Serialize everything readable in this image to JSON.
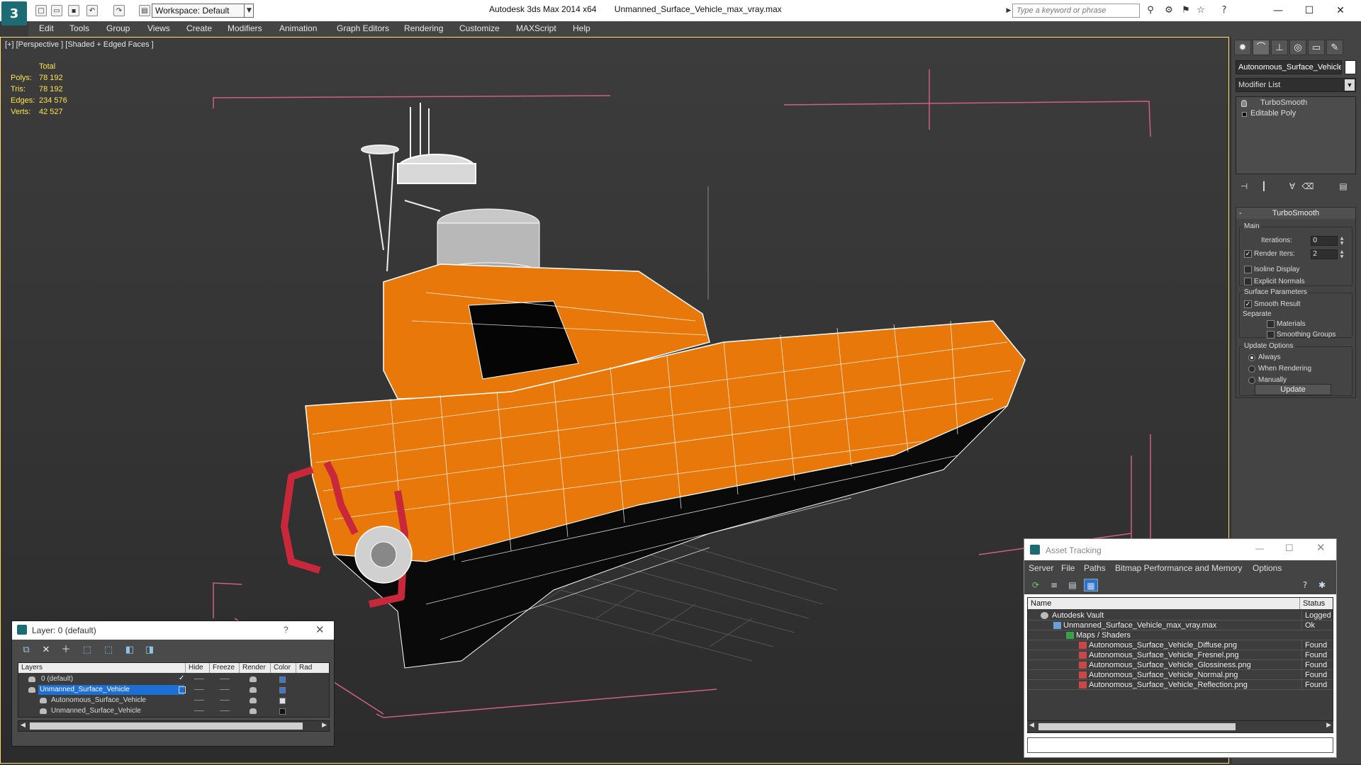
{
  "titlebar": {
    "app_name": "Autodesk 3ds Max  2014 x64",
    "file_name": "Unmanned_Surface_Vehicle_max_vray.max",
    "workspace": "Workspace: Default",
    "search_placeholder": "Type a keyword or phrase"
  },
  "menu": [
    "Edit",
    "Tools",
    "Group",
    "Views",
    "Create",
    "Modifiers",
    "Animation",
    "Graph Editors",
    "Rendering",
    "Customize",
    "MAXScript",
    "Help"
  ],
  "viewport": {
    "label": "[+] [Perspective ] [Shaded + Edged Faces ]",
    "stats": {
      "header": "Total",
      "rows": [
        {
          "label": "Polys:",
          "value": "78 192"
        },
        {
          "label": "Tris:",
          "value": "78 192"
        },
        {
          "label": "Edges:",
          "value": "234 576"
        },
        {
          "label": "Verts:",
          "value": "42 527"
        }
      ]
    },
    "colors": {
      "hull": "#e8780a",
      "wire": "#ffffff",
      "bbox": "#d06080",
      "grid": "#5a5a5a",
      "rail": "#c8283a"
    }
  },
  "command_panel": {
    "object_name": "Autonomous_Surface_Vehicle",
    "modifier_list": "Modifier List",
    "stack": [
      "TurboSmooth",
      "Editable Poly"
    ],
    "rollout": {
      "title": "TurboSmooth",
      "main_label": "Main",
      "iterations_label": "Iterations:",
      "iterations_value": "0",
      "render_iters_label": "Render Iters:",
      "render_iters_value": "2",
      "isoline_label": "Isoline Display",
      "explicit_normals_label": "Explicit Normals",
      "surface_label": "Surface Parameters",
      "smooth_result_label": "Smooth Result",
      "separate_label": "Separate",
      "materials_label": "Materials",
      "smoothing_groups_label": "Smoothing Groups",
      "update_options_label": "Update Options",
      "always_label": "Always",
      "when_rendering_label": "When Rendering",
      "manually_label": "Manually",
      "update_button": "Update"
    }
  },
  "layer_dialog": {
    "title": "Layer: 0 (default)",
    "help": "?",
    "columns": [
      "Layers",
      "Hide",
      "Freeze",
      "Render",
      "Color",
      "Rad"
    ],
    "rows": [
      {
        "name": "0 (default)",
        "color": "#3a78d8"
      },
      {
        "name": "Unmanned_Surface_Vehicle",
        "color": "#3a78d8"
      },
      {
        "name": "Autonomous_Surface_Vehicle",
        "color": "#e0e0e0"
      },
      {
        "name": "Unmanned_Surface_Vehicle",
        "color": "#111111"
      }
    ]
  },
  "asset_tracking": {
    "title": "Asset Tracking",
    "menu": [
      "Server",
      "File",
      "Paths",
      "Bitmap Performance and Memory",
      "Options"
    ],
    "columns": [
      "Name",
      "Status"
    ],
    "rows": [
      {
        "name": "Autodesk Vault",
        "status": "Logged O"
      },
      {
        "name": "Unmanned_Surface_Vehicle_max_vray.max",
        "status": "Ok"
      },
      {
        "name": "Maps / Shaders",
        "status": ""
      },
      {
        "name": "Autonomous_Surface_Vehicle_Diffuse.png",
        "status": "Found"
      },
      {
        "name": "Autonomous_Surface_Vehicle_Fresnel.png",
        "status": "Found"
      },
      {
        "name": "Autonomous_Surface_Vehicle_Glossiness.png",
        "status": "Found"
      },
      {
        "name": "Autonomous_Surface_Vehicle_Normal.png",
        "status": "Found"
      },
      {
        "name": "Autonomous_Surface_Vehicle_Reflection.png",
        "status": "Found"
      }
    ]
  }
}
